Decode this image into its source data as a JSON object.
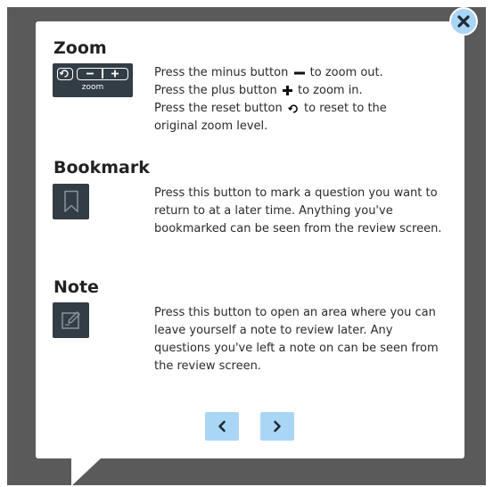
{
  "zoom": {
    "title": "Zoom",
    "widget_label": "zoom",
    "line1_a": "Press the minus button",
    "line1_b": "to zoom out.",
    "line2_a": "Press the plus button",
    "line2_b": "to zoom in.",
    "line3_a": "Press the reset button",
    "line3_b": "to reset to the",
    "line4": "original zoom level."
  },
  "bookmark": {
    "title": "Bookmark",
    "description": "Press this button to mark a question you want to return to at a later time. Anything you've bookmarked can be seen from the review screen."
  },
  "note": {
    "title": "Note",
    "description": "Press this button to open an area where you can leave yourself a note to review later. Any questions you've left a note on can be seen from the review screen."
  },
  "icons": {
    "close": "close-icon",
    "minus": "minus-icon",
    "plus": "plus-icon",
    "reset": "reset-icon",
    "bookmark": "bookmark-icon",
    "note": "note-icon",
    "prev": "chevron-left-icon",
    "next": "chevron-right-icon"
  },
  "colors": {
    "backdrop": "#5a5a5a",
    "accent": "#a9d6f5",
    "icon_tile": "#333d46",
    "icon_dark": "#1f2a36"
  }
}
